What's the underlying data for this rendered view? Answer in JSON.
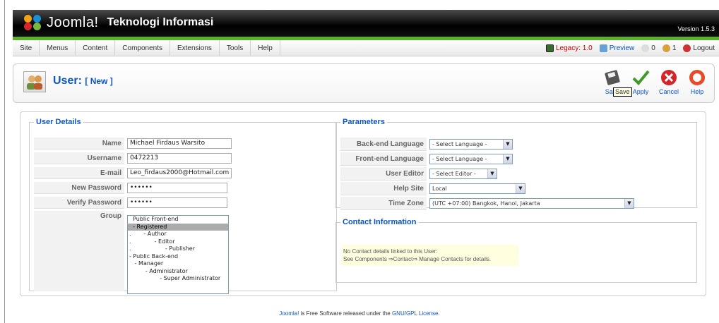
{
  "header": {
    "logo_text": "Joomla!",
    "site_title": "Teknologi Informasi",
    "version": "Version 1.5.3"
  },
  "menu": [
    "Site",
    "Menus",
    "Content",
    "Components",
    "Extensions",
    "Tools",
    "Help"
  ],
  "status": {
    "legacy": "Legacy: 1.0",
    "preview": "Preview",
    "messages": "0",
    "users": "1",
    "logout": "Logout"
  },
  "toolbar": {
    "title": "User:",
    "subtitle": "[ New ]",
    "buttons": [
      {
        "label": "Save",
        "icon": "save-icon"
      },
      {
        "label": "Apply",
        "icon": "apply-icon"
      },
      {
        "label": "Cancel",
        "icon": "cancel-icon"
      },
      {
        "label": "Help",
        "icon": "help-icon"
      }
    ],
    "tooltip": "Save"
  },
  "user_details": {
    "legend": "User Details",
    "name_label": "Name",
    "name_value": "Michael Firdaus Warsito",
    "username_label": "Username",
    "username_value": "0472213",
    "email_label": "E-mail",
    "email_value": "Leo_firdaus2000@Hotmail.com",
    "new_password_label": "New Password",
    "new_password_value": "••••••",
    "verify_password_label": "Verify Password",
    "verify_password_value": "••••••",
    "group_label": "Group",
    "groups": [
      "  Public Front-end",
      "  - Registered",
      ".       - Author",
      ".             - Editor",
      ".                   - Publisher",
      "- Public Back-end",
      "   - Manager",
      "         - Administrator",
      "                 - Super Administrator"
    ],
    "selected_group": 1
  },
  "parameters": {
    "legend": "Parameters",
    "rows": [
      {
        "label": "Back-end Language",
        "value": "- Select Language -"
      },
      {
        "label": "Front-end Language",
        "value": "- Select Language -"
      },
      {
        "label": "User Editor",
        "value": "- Select Editor -"
      },
      {
        "label": "Help Site",
        "value": "Local"
      },
      {
        "label": "Time Zone",
        "value": "(UTC +07:00) Bangkok, Hanoi, Jakarta"
      }
    ]
  },
  "contact": {
    "legend": "Contact Information",
    "line1": "No Contact details linked to this User:",
    "line2": "See Components ⇒Contact⇒ Manage Contacts for details."
  },
  "footer": {
    "brand": "Joomla!",
    "text": " is Free Software released under the ",
    "license": "GNU/GPL License",
    "end": "."
  },
  "colors": {
    "accent": "#0b55c4",
    "green": "#5cb030",
    "header_bg": "#000000"
  }
}
